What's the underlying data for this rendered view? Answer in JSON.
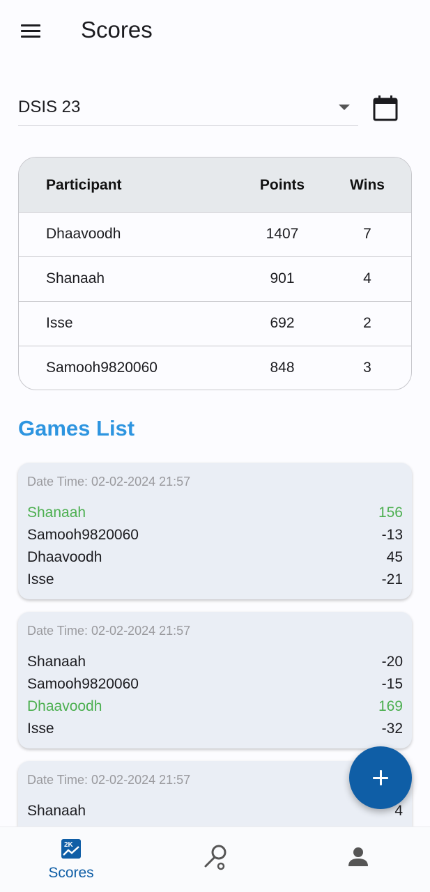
{
  "appbar": {
    "title": "Scores",
    "menu_icon": "hamburger-menu-icon"
  },
  "selector": {
    "value": "DSIS 23",
    "dropdown_icon": "arrow-drop-down-icon",
    "calendar_icon": "calendar-icon"
  },
  "table": {
    "headers": {
      "participant": "Participant",
      "points": "Points",
      "wins": "Wins"
    },
    "rows": [
      {
        "name": "Dhaavoodh",
        "points": "1407",
        "wins": "7"
      },
      {
        "name": "Shanaah",
        "points": "901",
        "wins": "4"
      },
      {
        "name": "Isse",
        "points": "692",
        "wins": "2"
      },
      {
        "name": "Samooh9820060",
        "points": "848",
        "wins": "3"
      }
    ]
  },
  "games": {
    "title": "Games List",
    "items": [
      {
        "datetime": "Date Time: 02-02-2024 21:57",
        "players": [
          {
            "name": "Shanaah",
            "score": "156",
            "winner": true
          },
          {
            "name": "Samooh9820060",
            "score": "-13",
            "winner": false
          },
          {
            "name": "Dhaavoodh",
            "score": "45",
            "winner": false
          },
          {
            "name": "Isse",
            "score": "-21",
            "winner": false
          }
        ]
      },
      {
        "datetime": "Date Time: 02-02-2024 21:57",
        "players": [
          {
            "name": "Shanaah",
            "score": "-20",
            "winner": false
          },
          {
            "name": "Samooh9820060",
            "score": "-15",
            "winner": false
          },
          {
            "name": "Dhaavoodh",
            "score": "169",
            "winner": true
          },
          {
            "name": "Isse",
            "score": "-32",
            "winner": false
          }
        ]
      },
      {
        "datetime": "Date Time: 02-02-2024 21:57",
        "players": [
          {
            "name": "Shanaah",
            "score": "4",
            "winner": false
          }
        ]
      }
    ]
  },
  "fab": {
    "icon": "add-icon"
  },
  "bottom_nav": {
    "items": [
      {
        "label": "Scores",
        "icon": "scores-chart-icon",
        "active": true
      },
      {
        "label": "",
        "icon": "search-icon",
        "active": false
      },
      {
        "label": "",
        "icon": "person-icon",
        "active": false
      }
    ]
  },
  "colors": {
    "accent": "#0f5ea6",
    "section_title": "#2e95e0",
    "winner": "#4caf50",
    "card_bg": "#eaeef5",
    "table_header_bg": "#e6e9ec"
  }
}
